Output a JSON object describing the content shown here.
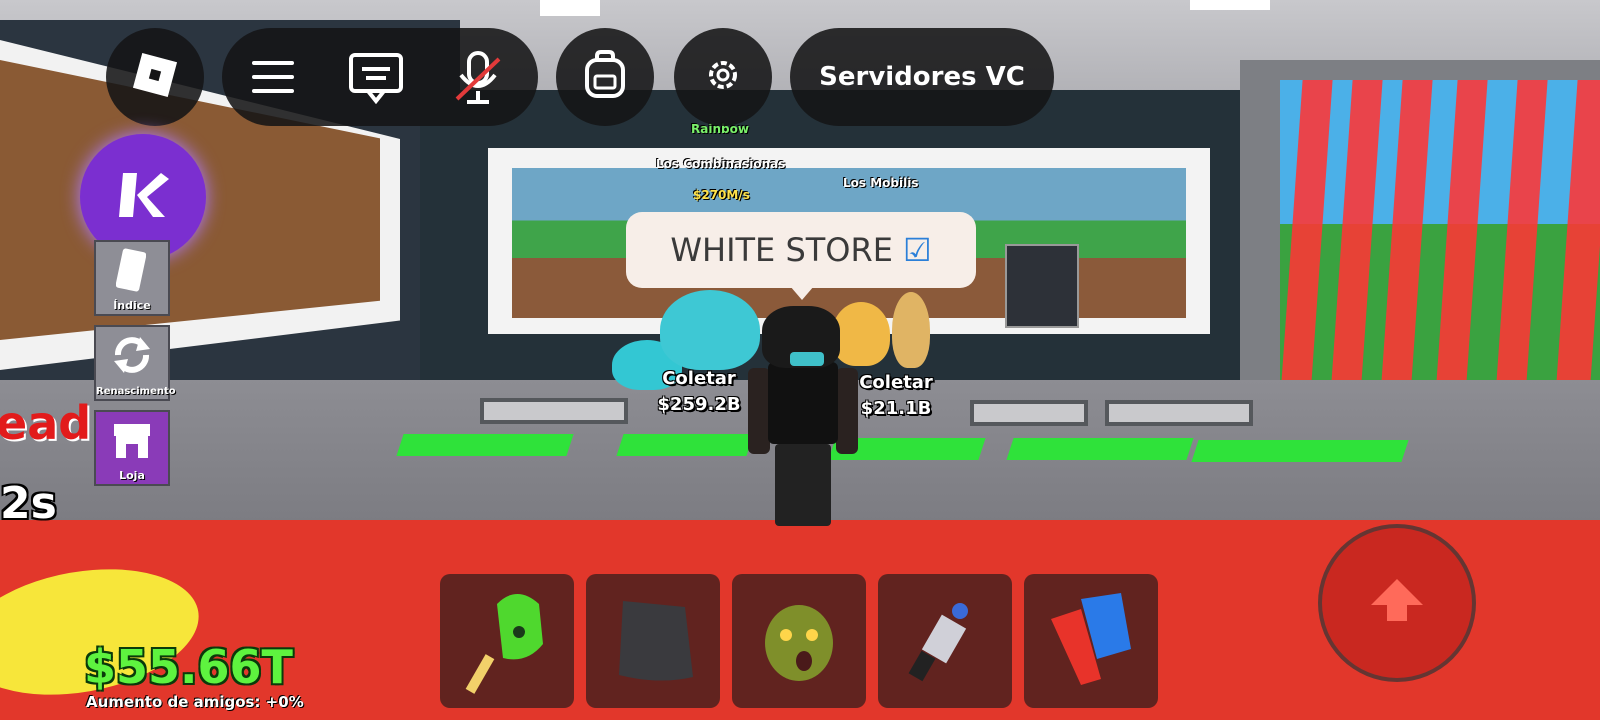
{
  "topbar": {
    "servers_label": "Servidores VC"
  },
  "icons": {
    "roblox": "roblox-logo-icon",
    "menu": "hamburger-menu-icon",
    "chat": "chat-icon",
    "mic": "microphone-muted-icon",
    "backpack": "backpack-icon",
    "settings": "gear-icon",
    "k_app": "k-letter-icon",
    "jump": "arrow-up-icon"
  },
  "sidebar": {
    "items": [
      {
        "label": "Índice"
      },
      {
        "label": "Renascimento"
      },
      {
        "label": "Loja"
      }
    ]
  },
  "store_sign": {
    "text": "WHITE STORE",
    "check": "☑"
  },
  "world_labels": {
    "rainbow": "Rainbow",
    "left_name": "Los Combinasionas",
    "left_rate": "$270M/s",
    "mid_name": "Los Mobilis"
  },
  "collect": [
    {
      "title": "Coletar",
      "amount": "$259.2B"
    },
    {
      "title": "Coletar",
      "amount": "$21.1B"
    }
  ],
  "left_edge": {
    "partial_word": "ead",
    "timer": "2s"
  },
  "hud": {
    "money": "$55.66T",
    "friends_boost": "Aumento de amigos: +0%"
  },
  "hotbar": {
    "items": [
      "green-slap-glove-icon",
      "black-cape-icon",
      "zombie-head-icon",
      "gadget-tool-icon",
      "red-blue-cross-icon"
    ]
  },
  "colors": {
    "money": "#5ef33f",
    "lava": "#e2372b",
    "pad": "#2fe23a",
    "k_purple": "#7b2fd0"
  }
}
